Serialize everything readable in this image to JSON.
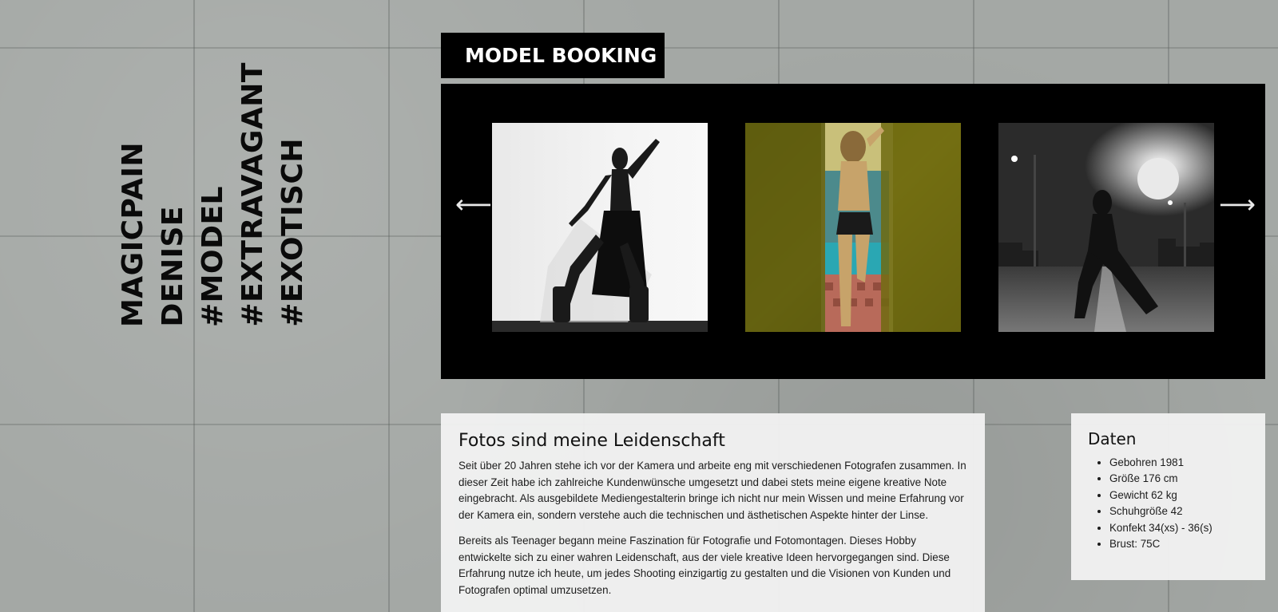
{
  "tags": [
    "MAGICPAIN",
    "DENISE",
    "#MODEL",
    "#EXTRAVAGANT",
    "#EXOTISCH"
  ],
  "header": {
    "title": "MODEL BOOKING"
  },
  "carousel": {
    "prev_icon": "arrow-left-icon",
    "next_icon": "arrow-right-icon",
    "prev_glyph": "⟵",
    "next_glyph": "⟶"
  },
  "about": {
    "heading": "Fotos sind meine Leidenschaft",
    "paragraphs": [
      "Seit über 20 Jahren stehe ich vor der Kamera und arbeite eng mit verschiedenen Fotografen zusammen. In dieser Zeit habe ich zahlreiche Kundenwünsche umgesetzt und dabei stets meine eigene kreative Note eingebracht. Als ausgebildete Mediengestalterin bringe ich nicht nur mein Wissen und meine Erfahrung vor der Kamera ein, sondern verstehe auch die technischen und ästhetischen Aspekte hinter der Linse.",
      "Bereits als Teenager begann meine Faszination für Fotografie und Fotomontagen. Dieses Hobby entwickelte sich zu einer wahren Leidenschaft, aus der viele kreative Ideen hervorgegangen sind. Diese Erfahrung nutze ich heute, um jedes Shooting einzigartig zu gestalten und die Visionen von Kunden und Fotografen optimal umzusetzen."
    ]
  },
  "facts": {
    "heading": "Daten",
    "items": [
      "Gebohren 1981",
      "Größe 176 cm",
      "Gewicht 62 kg",
      "Schuhgröße 42",
      "Konfekt 34(xs) - 36(s)",
      "Brust: 75C"
    ]
  },
  "colors": {
    "panel_bg": "#f2f2f2",
    "carousel_bg": "#000000",
    "text": "#1c1c1c"
  }
}
